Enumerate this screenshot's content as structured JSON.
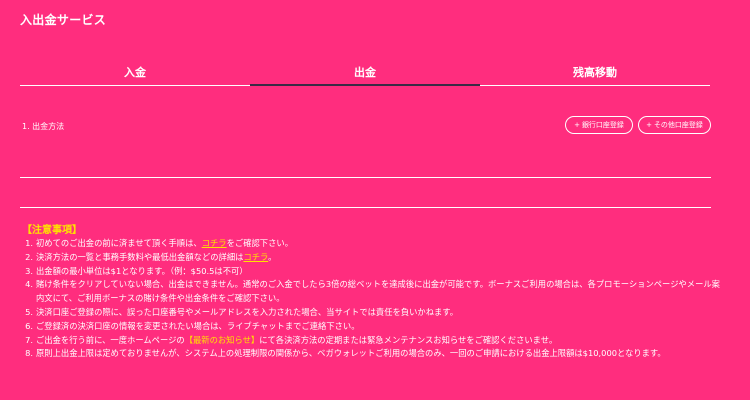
{
  "title": "入出金サービス",
  "tabs": [
    {
      "label": "入金",
      "active": false
    },
    {
      "label": "出金",
      "active": true
    },
    {
      "label": "残高移動",
      "active": false
    }
  ],
  "method": {
    "label": "1. 出金方法",
    "buttons": [
      {
        "icon": "+",
        "label": "銀行口座登録"
      },
      {
        "icon": "+",
        "label": "その他口座登録"
      }
    ]
  },
  "notes": {
    "title": "【注意事項】",
    "items": [
      {
        "num": "1.",
        "pre": "初めてのご出金の前に済ませて頂く手順は、",
        "link": "コチラ",
        "post": "をご確認下さい。"
      },
      {
        "num": "2.",
        "pre": "決済方法の一覧と事務手数料や最低出金額などの詳細は",
        "link": "コチラ",
        "post": "。"
      },
      {
        "num": "3.",
        "text": "出金額の最小単位は$1となります。（例：$50.5は不可）"
      },
      {
        "num": "4.",
        "text": "賭け条件をクリアしていない場合、出金はできません。通常のご入金でしたら3倍の総ベットを達成後に出金が可能です。ボーナスご利用の場合は、各プロモーションページやメール案内文にて、ご利用ボーナスの賭け条件や出金条件をご確認下さい。"
      },
      {
        "num": "5.",
        "text": "決済口座ご登録の際に、誤った口座番号やメールアドレスを入力された場合、当サイトでは責任を負いかねます。"
      },
      {
        "num": "6.",
        "text": "ご登録済の決済口座の情報を変更されたい場合は、ライブチャットまでご連絡下さい。"
      },
      {
        "num": "7.",
        "pre": "ご出金を行う前に、一度ホームページの",
        "highlight": "【最新のお知らせ】",
        "post": "にて各決済方法の定期または緊急メンテナンスお知らせをご確認くださいませ。"
      },
      {
        "num": "8.",
        "text": "原則上出金上限は定めておりませんが、システム上の処理制限の関係から、ベガウォレットご利用の場合のみ、一回のご申請における出金上限額は$10,000となります。"
      }
    ]
  },
  "colors": {
    "background": "#ff2d7e",
    "accent": "#ffe100",
    "active_tab_line": "#3a2a45"
  }
}
